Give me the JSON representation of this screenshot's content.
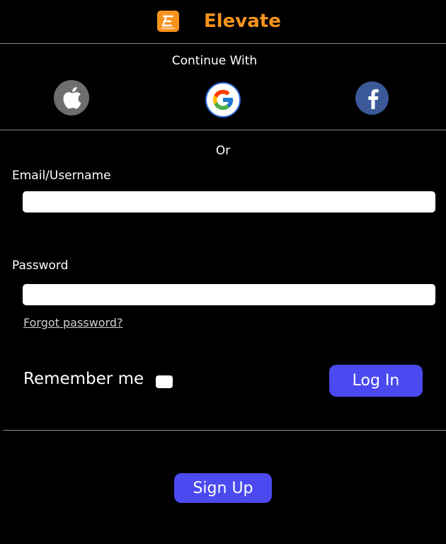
{
  "header": {
    "brand_name": "Elevate",
    "brand_color": "#f7941d",
    "logo_icon": "elevate-logo-icon"
  },
  "social": {
    "heading": "Continue With",
    "providers": [
      {
        "name": "Apple",
        "icon": "apple-icon",
        "color": "#6e6e6e"
      },
      {
        "name": "Google",
        "icon": "google-icon",
        "color": "#ffffff"
      },
      {
        "name": "Facebook",
        "icon": "facebook-icon",
        "color": "#3b5998"
      }
    ]
  },
  "separator_text": "Or",
  "form": {
    "email_label": "Email/Username",
    "email_value": "",
    "password_label": "Password",
    "password_value": "",
    "forgot_link": "Forgot password?",
    "remember_label": "Remember me",
    "remember_checked": false,
    "login_label": "Log In"
  },
  "signup_label": "Sign Up",
  "accent_color": "#4a4af0"
}
